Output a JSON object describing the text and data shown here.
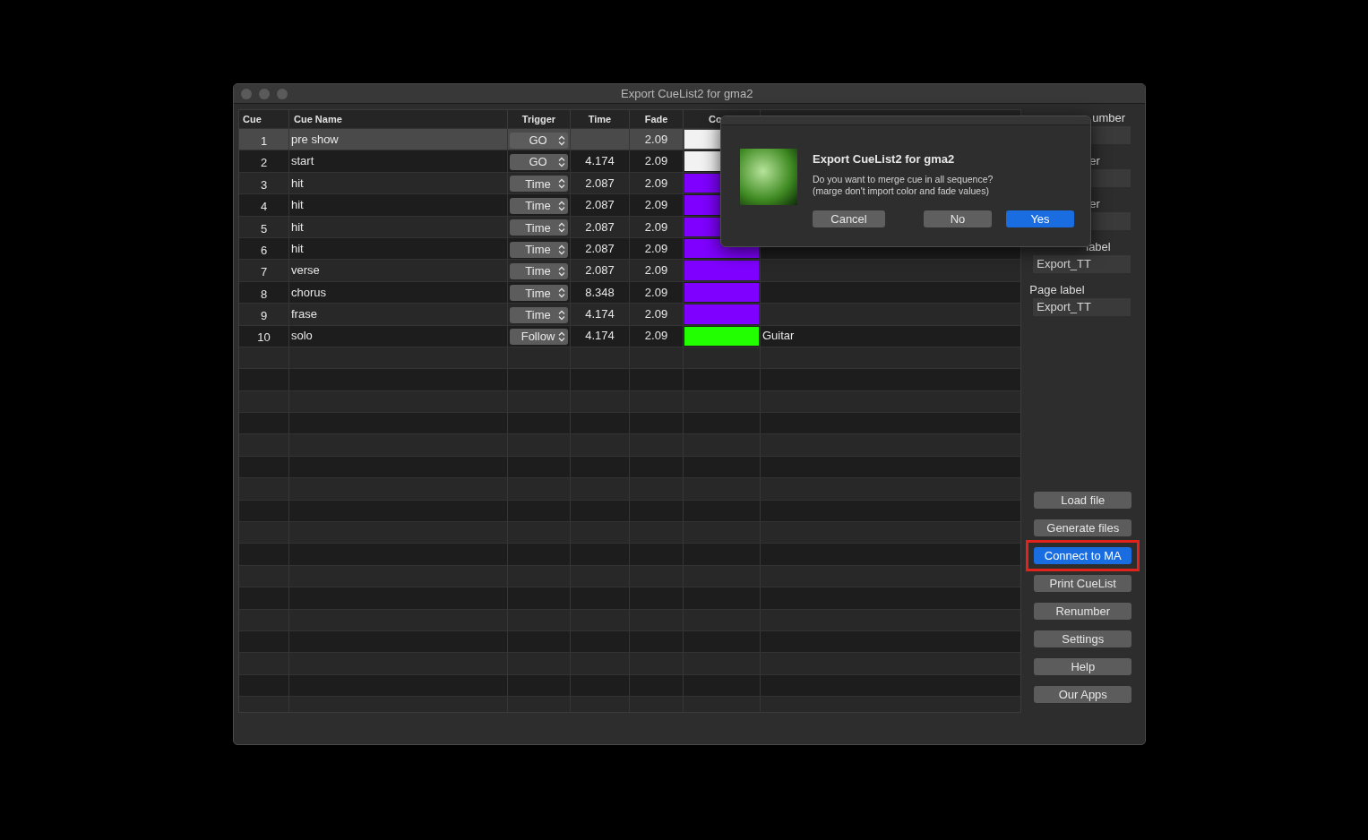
{
  "window": {
    "title": "Export CueList2 for gma2"
  },
  "table": {
    "columns": [
      "Cue",
      "Cue Name",
      "Trigger",
      "Time",
      "Fade",
      "Co"
    ],
    "rows": [
      {
        "cue": "1",
        "name": "pre show",
        "trigger": "GO",
        "fade": "2.09",
        "color": "#f2f2f2",
        "selected": true
      },
      {
        "cue": "2",
        "name": "start",
        "trigger": "GO",
        "time": "4.174",
        "fade": "2.09",
        "color": "#f2f2f2",
        "selected": false
      },
      {
        "cue": "3",
        "name": "hit",
        "trigger": "Time",
        "time": "2.087",
        "fade": "2.09",
        "color": "#7f00ff",
        "selected": false
      },
      {
        "cue": "4",
        "name": "hit",
        "trigger": "Time",
        "time": "2.087",
        "fade": "2.09",
        "color": "#7f00ff",
        "selected": false
      },
      {
        "cue": "5",
        "name": "hit",
        "trigger": "Time",
        "time": "2.087",
        "fade": "2.09",
        "color": "#7f00ff",
        "selected": false
      },
      {
        "cue": "6",
        "name": "hit",
        "trigger": "Time",
        "time": "2.087",
        "fade": "2.09",
        "color": "#7f00ff",
        "selected": false
      },
      {
        "cue": "7",
        "name": "verse",
        "trigger": "Time",
        "time": "2.087",
        "fade": "2.09",
        "color": "#7f00ff",
        "selected": false
      },
      {
        "cue": "8",
        "name": "chorus",
        "trigger": "Time",
        "time": "8.348",
        "fade": "2.09",
        "color": "#7f00ff",
        "selected": false
      },
      {
        "cue": "9",
        "name": "frase",
        "trigger": "Time",
        "time": "4.174",
        "fade": "2.09",
        "color": "#7f00ff",
        "selected": false
      },
      {
        "cue": "10",
        "name": "solo",
        "trigger": "Follow",
        "time": "4.174",
        "fade": "2.09",
        "color": "#22ff00",
        "note": "Guitar",
        "selected": false
      }
    ]
  },
  "side_panel": {
    "fields": [
      {
        "label": "umber"
      },
      {
        "label": "er"
      },
      {
        "label": "er"
      },
      {
        "label": "label",
        "value": "Export_TT"
      },
      {
        "label": "Page label",
        "value": "Export_TT"
      }
    ],
    "buttons": [
      {
        "label": "Load file",
        "primary": false,
        "highlighted": false
      },
      {
        "label": "Generate files",
        "primary": false,
        "highlighted": false
      },
      {
        "label": "Connect to MA",
        "primary": true,
        "highlighted": true
      },
      {
        "label": "Print CueList",
        "primary": false,
        "highlighted": false
      },
      {
        "label": "Renumber",
        "primary": false,
        "highlighted": false
      },
      {
        "label": "Settings",
        "primary": false,
        "highlighted": false
      },
      {
        "label": "Help",
        "primary": false,
        "highlighted": false
      },
      {
        "label": "Our Apps",
        "primary": false,
        "highlighted": false
      }
    ]
  },
  "dialog": {
    "title": "Export CueList2 for gma2",
    "message": "Do you want to merge cue in all sequence?\n(marge don't import color and fade values)",
    "buttons": [
      {
        "label": "Cancel",
        "default": false
      },
      {
        "label": "No",
        "default": false
      },
      {
        "label": "Yes",
        "default": true
      }
    ]
  }
}
